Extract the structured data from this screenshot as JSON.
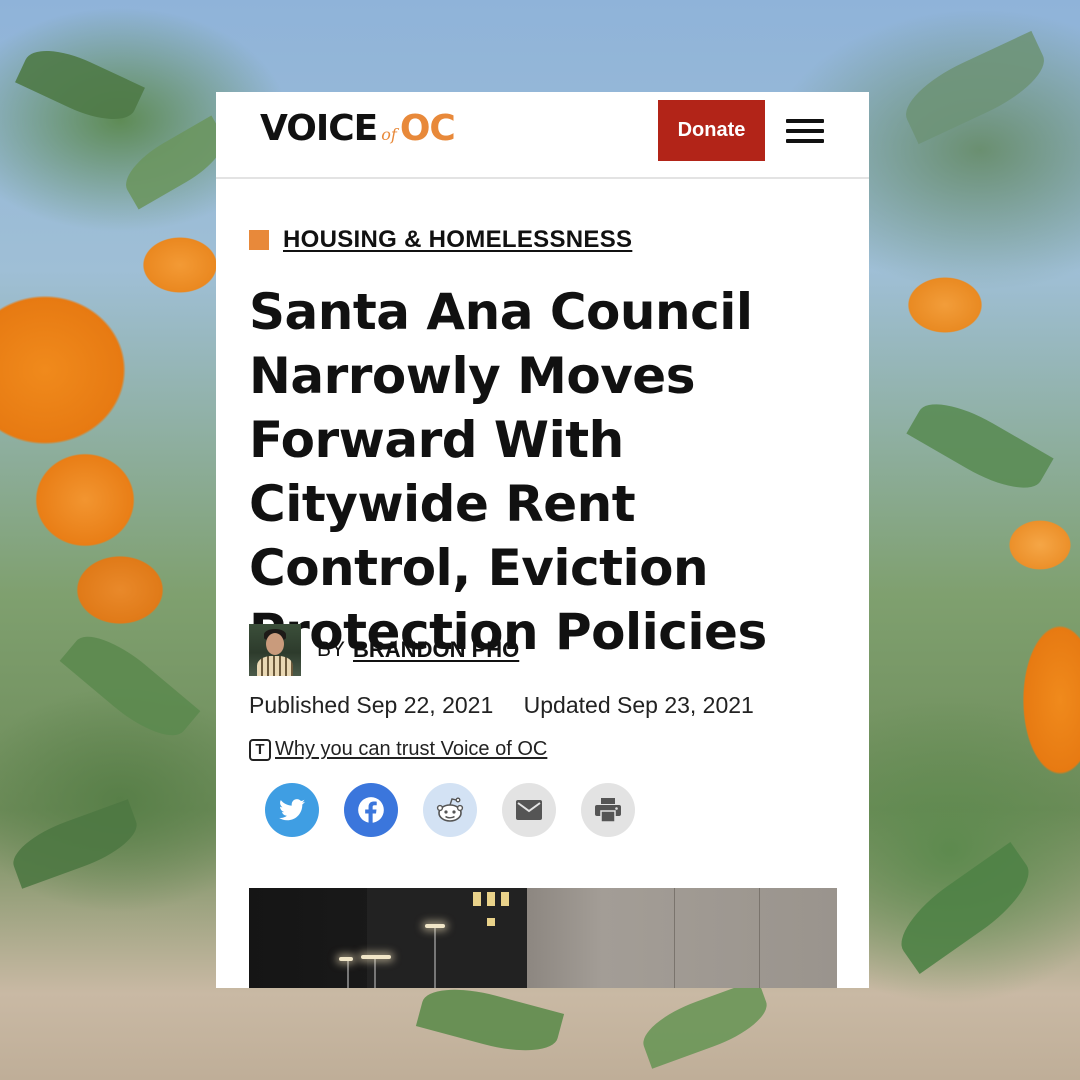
{
  "site": {
    "logo": {
      "voice": "VOICE",
      "of": "of",
      "oc": "OC"
    },
    "donate_label": "Donate",
    "menu_icon": "hamburger-menu-icon"
  },
  "article": {
    "category": "HOUSING & HOMELESSNESS",
    "headline": "Santa Ana Council Narrowly Moves Forward With Citywide Rent Control, Eviction Protection Policies",
    "byline_prefix": "BY",
    "author": "BRANDON PHO",
    "published": "Published Sep 22, 2021",
    "updated": "Updated Sep 23, 2021",
    "trust_icon_glyph": "T",
    "trust_link": " Why you can trust Voice of OC"
  },
  "share_buttons": [
    {
      "name": "twitter",
      "icon": "twitter-icon",
      "color": "#3f9ee3"
    },
    {
      "name": "facebook",
      "icon": "facebook-icon",
      "color": "#3b76dc"
    },
    {
      "name": "reddit",
      "icon": "reddit-icon",
      "color": "#d3e2f4"
    },
    {
      "name": "email",
      "icon": "envelope-icon",
      "color": "#e3e3e3"
    },
    {
      "name": "print",
      "icon": "printer-icon",
      "color": "#e3e3e3"
    }
  ],
  "colors": {
    "brand_orange": "#e8893a",
    "donate_red": "#b22418",
    "text": "#111111"
  }
}
